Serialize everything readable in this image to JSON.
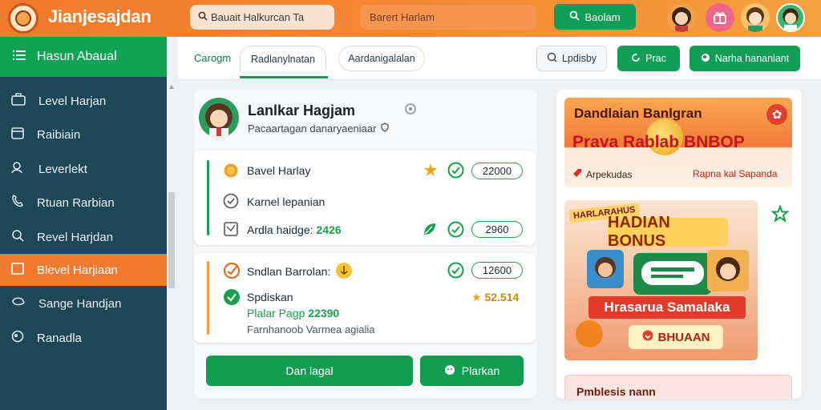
{
  "header": {
    "brand": "Jianjesajdan",
    "search_placeholder": "Bauait Halkurcan Ta",
    "search2_placeholder": "Barert Harlam",
    "search_button": "Baolam"
  },
  "sidebar": {
    "title": "Hasun Abaual",
    "items": [
      {
        "label": "Level Harjan",
        "icon": "suitcase-icon"
      },
      {
        "label": "Raibiain",
        "icon": "calendar-icon"
      },
      {
        "label": "Leverlekt",
        "icon": "people-icon"
      },
      {
        "label": "Rtuan Rarbian",
        "icon": "phone-icon"
      },
      {
        "label": "Revel Harjdan",
        "icon": "search-icon"
      },
      {
        "label": "Blevel Harjiaan",
        "icon": "calendar-icon"
      },
      {
        "label": "Sange Handjan",
        "icon": "wallet-icon"
      },
      {
        "label": "Ranadla",
        "icon": "globe-icon"
      }
    ],
    "active_index": 5
  },
  "tabs": {
    "label": "Carogm",
    "items": [
      "Radlanylnatan",
      "Aardanigalalan"
    ],
    "tools": {
      "display": "Lpdisby",
      "primary": "Prac",
      "secondary": "Narha hananlant"
    }
  },
  "profile": {
    "name": "Lanlkar Hagjam",
    "subtitle": "Pacaartagan danaryaeniaar"
  },
  "list1": [
    {
      "label": "Bavel Harlay",
      "value": "22000"
    },
    {
      "label": "Karnel lepanian",
      "value": ""
    },
    {
      "label": "Ardla haidge:",
      "extra": "2426",
      "value": "2960"
    }
  ],
  "list2": {
    "row1_label": "Sndlan Barrolan:",
    "row1_value": "12600",
    "row2_label": "Spdiskan",
    "row2_sub": "Plalar Pagp",
    "row2_sub_value": "22390",
    "row2_star_value": "52.514",
    "row2_note": "Farnhanoob Varmea agialia"
  },
  "actions": {
    "primary": "Dan lagal",
    "secondary": "Plarkan"
  },
  "promos": {
    "p1_title": "Dandlaian Banlgran",
    "p1_banner": "Prava Rablab BNBOP",
    "p1_left": "Arpekudas",
    "p1_right": "Rapna kal Sapanda",
    "p2_small": "HARLARAHUS",
    "p2_title": "HADIAN BONUS",
    "p2_strip": "Hrasarua Samalaka",
    "p2_tag": "BHUAAN",
    "p3_text": "Pmblesis nann"
  },
  "colors": {
    "accent_orange": "#f17a30",
    "accent_green": "#0f9d58",
    "sidebar_bg": "#1d4656"
  }
}
